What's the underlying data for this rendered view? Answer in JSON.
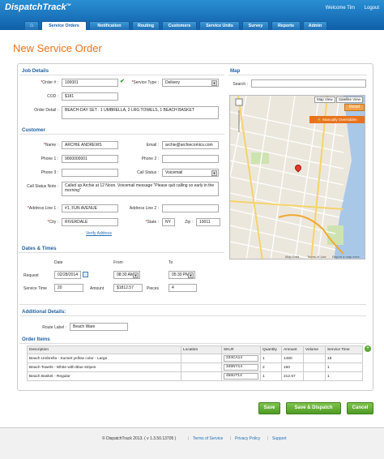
{
  "app": {
    "logo": "DispatchTrack",
    "tm": "TM",
    "welcome": "Welcome Tim",
    "logout": "Logout"
  },
  "nav": {
    "home_icon": "home-icon",
    "tabs": [
      "Service Orders",
      "Notification",
      "Routing",
      "Customers",
      "Service Units",
      "Survey",
      "Reports",
      "Admin"
    ]
  },
  "page": {
    "title": "New Service Order"
  },
  "job": {
    "heading": "Job Details",
    "order_label": "Order # :",
    "order_value": "100001",
    "service_type_label": "Service Type :",
    "service_type_value": "Delivery",
    "cod_label": "COD :",
    "cod_value": "$181",
    "detail_label": "Order Detail :",
    "detail_value": "BEACH-DAY SET : 1 UMBRELLA, 2 LRG TOWELS, 1 BEACH BASKET"
  },
  "customer": {
    "heading": "Customer",
    "name_label": "Name :",
    "name_value": "ARCHIE ANDREWS",
    "email_label": "Email :",
    "email_value": "archie@archiecomics.com",
    "phone1_label": "Phone 1 :",
    "phone1_value": "9000000001",
    "phone2_label": "Phone 2 :",
    "phone2_value": "",
    "phone3_label": "Phone 3 :",
    "phone3_value": "",
    "call_status_label": "Call Status :",
    "call_status_value": "Voicemail",
    "call_note_label": "Call Status Note :",
    "call_note_value": "Called up Archie at 12 Noon. Voicemail message \"Please quit calling so early in the morning\"",
    "addr1_label": "Address Line 1 :",
    "addr1_value": "#1, FUN AVENUE",
    "addr2_label": "Address Line 2 :",
    "addr2_value": "",
    "city_label": "City :",
    "city_value": "RIVERDALE",
    "state_label": "State :",
    "state_value": "NY",
    "zip_label": "Zip :",
    "zip_value": "10011",
    "verify_link": "Verify Address"
  },
  "map": {
    "heading": "Map",
    "search_label": "Search :",
    "search_value": "",
    "map_view": "Map View",
    "satellite_view": "Satellite View",
    "reset": "Reset",
    "manual_override": "Manually Overridden",
    "map_data": "Map Data",
    "terms": "Terms of Use",
    "report": "Report a map error"
  },
  "dates": {
    "heading": "Dates & Times",
    "date_head": "Date",
    "from_head": "From",
    "to_head": "To",
    "request_label": "Request",
    "request_date": "02/28/2014",
    "from_time": "08:30 AM",
    "to_time": "05:30 PM",
    "service_time_label": "Service Time",
    "service_time_value": "20",
    "amount_label": "Amount",
    "amount_value": "$1812.57",
    "pieces_label": "Pieces",
    "pieces_value": "4"
  },
  "additional": {
    "heading": "Additional Details:",
    "route_label": "Route Label :",
    "route_value": "Beach Ware"
  },
  "items": {
    "heading": "Order Items",
    "columns": [
      "Description",
      "Location",
      "SKU#",
      "Quantity",
      "Amount",
      "Volume",
      "Service Time"
    ],
    "rows": [
      [
        "Beach Umbrella - Sunset yellow color - Large",
        "",
        "234CA14",
        "1",
        "1450",
        "",
        "18"
      ],
      [
        "Beach Towels - White with Blue stripes",
        "",
        "345NY14",
        "2",
        "150",
        "",
        "1"
      ],
      [
        "Beach Basket - Regular",
        "",
        "456UT14",
        "1",
        "212.57",
        "",
        "1"
      ]
    ]
  },
  "actions": {
    "save": "Save",
    "save_dispatch": "Save & Dispatch",
    "cancel": "Cancel"
  },
  "footer": {
    "copyright": "© DispatchTrack 2013.  ( v 1.3.50.13705 )",
    "terms": "Terms of Service",
    "privacy": "Privacy Policy",
    "support": "Support"
  }
}
